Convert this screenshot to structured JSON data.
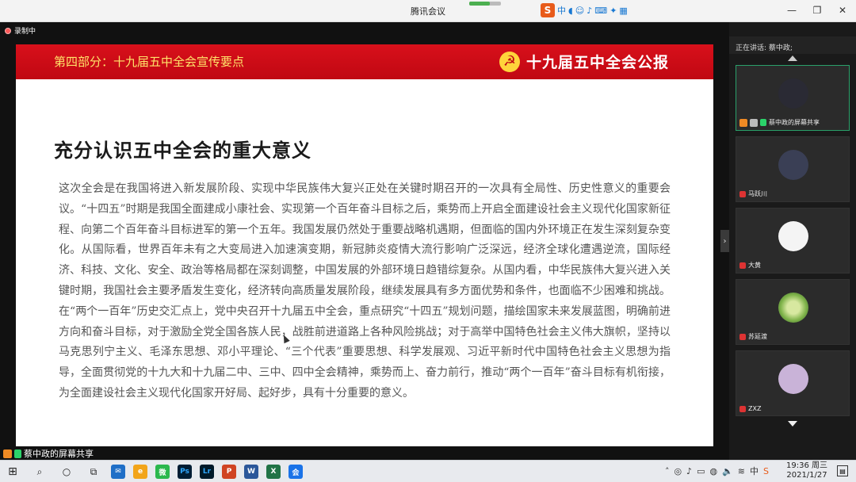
{
  "window": {
    "title": "腾讯会议",
    "ime_label": "中"
  },
  "recording": {
    "label": "录制中"
  },
  "slide": {
    "part_title": "第四部分：十九届五中全会宣传要点",
    "brand": "十九届五中全会公报",
    "heading": "充分认识五中全会的重大意义",
    "paragraph": "这次全会是在我国将进入新发展阶段、实现中华民族伟大复兴正处在关键时期召开的一次具有全局性、历史性意义的重要会议。“十四五”时期是我国全面建成小康社会、实现第一个百年奋斗目标之后，乘势而上开启全面建设社会主义现代化国家新征程、向第二个百年奋斗目标进军的第一个五年。我国发展仍然处于重要战略机遇期，但面临的国内外环境正在发生深刻复杂变化。从国际看，世界百年未有之大变局进入加速演变期，新冠肺炎疫情大流行影响广泛深远，经济全球化遭遇逆流，国际经济、科技、文化、安全、政治等格局都在深刻调整，中国发展的外部环境日趋错综复杂。从国内看，中华民族伟大复兴进入关键时期，我国社会主要矛盾发生变化，经济转向高质量发展阶段，继续发展具有多方面优势和条件，也面临不少困难和挑战。在“两个一百年”历史交汇点上，党中央召开十九届五中全会，重点研究“十四五”规划问题，描绘国家未来发展蓝图，明确前进方向和奋斗目标，对于激励全党全国各族人民，战胜前进道路上各种风险挑战；对于高举中国特色社会主义伟大旗帜，坚持以马克思列宁主义、毛泽东思想、邓小平理论、“三个代表”重要思想、科学发展观、习近平新时代中国特色社会主义思想为指导，全面贯彻党的十九大和十九届二中、三中、四中全会精神，乘势而上、奋力前行，推动“两个一百年”奋斗目标有机衔接，为全面建设社会主义现代化国家开好局、起好步，具有十分重要的意义。"
  },
  "panel": {
    "speaking": "正在讲话: 蔡中政;",
    "participants": [
      {
        "name": "蔡中政的屏幕共享",
        "avatar_color": "#2a2a34"
      },
      {
        "name": "马跃川",
        "avatar_color": "#3a3f55"
      },
      {
        "name": "大黄",
        "avatar_color": "#f4f4f4"
      },
      {
        "name": "苏延渡",
        "avatar_color": "#7fb34a"
      },
      {
        "name": "ZXZ",
        "avatar_color": "#c9b3d8"
      }
    ]
  },
  "share_bar": {
    "label": "蔡中政的屏幕共享"
  },
  "taskbar": {
    "apps": [
      {
        "icon": "mail-icon",
        "glyph": "✉",
        "color": "#1f6fc7"
      },
      {
        "icon": "browser-icon",
        "glyph": "e",
        "color": "#f2a51a"
      },
      {
        "icon": "wechat-icon",
        "glyph": "微",
        "color": "#2bb84d"
      },
      {
        "icon": "photoshop-icon",
        "glyph": "Ps",
        "color": "#001d34"
      },
      {
        "icon": "lightroom-icon",
        "glyph": "Lr",
        "color": "#001a2a"
      },
      {
        "icon": "powerpoint-icon",
        "glyph": "P",
        "color": "#d04423"
      },
      {
        "icon": "word-icon",
        "glyph": "W",
        "color": "#2b579a"
      },
      {
        "icon": "excel-icon",
        "glyph": "X",
        "color": "#217346"
      },
      {
        "icon": "tencent-meeting-icon",
        "glyph": "会",
        "color": "#1a73e8"
      }
    ],
    "time": "19:36 周三",
    "date": "2021/1/27",
    "ime": "中"
  }
}
